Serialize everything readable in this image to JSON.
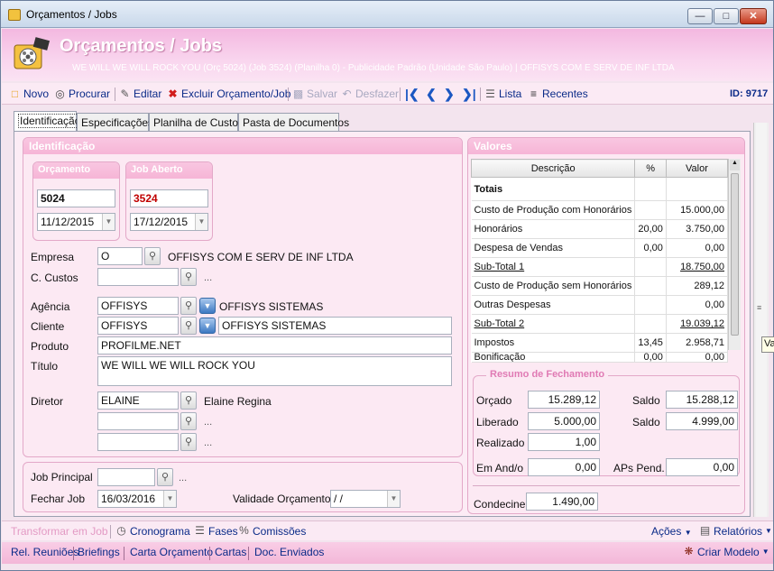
{
  "window": {
    "title": "Orçamentos / Jobs"
  },
  "banner": {
    "title": "Orçamentos / Jobs",
    "subtitle": "WE WILL WE WILL ROCK YOU (Orç 5024) (Job 3524)  (Planilha 0) - Publicidade Padrão (Unidade São Paulo) | OFFISYS COM E SERV DE INF LTDA"
  },
  "toolbar": {
    "novo": "Novo",
    "procurar": "Procurar",
    "editar": "Editar",
    "excluir": "Excluir Orçamento/Job",
    "salvar": "Salvar",
    "desfazer": "Desfazer",
    "lista": "Lista",
    "recentes": "Recentes",
    "id": "ID: 9717"
  },
  "tabs": [
    "Identificação",
    "Especificações",
    "Planilha de Custos",
    "Pasta de Documentos"
  ],
  "identificacao": {
    "header": "Identificação",
    "orcamento": {
      "label": "Orçamento",
      "number": "5024",
      "date": "11/12/2015"
    },
    "job": {
      "label": "Job Aberto",
      "number": "3524",
      "date": "17/12/2015"
    },
    "empresa": {
      "label": "Empresa",
      "code": "O",
      "name": "OFFISYS COM E SERV DE INF LTDA"
    },
    "custos": {
      "label": "C. Custos",
      "value": "",
      "dots": "..."
    },
    "agencia": {
      "label": "Agência",
      "code": "OFFISYS",
      "name": "OFFISYS SISTEMAS"
    },
    "cliente": {
      "label": "Cliente",
      "code": "OFFISYS",
      "name": "OFFISYS SISTEMAS"
    },
    "produto": {
      "label": "Produto",
      "value": "PROFILME.NET"
    },
    "titulo": {
      "label": "Título",
      "value": "WE WILL WE WILL ROCK YOU"
    },
    "diretor": {
      "label": "Diretor",
      "code": "ELAINE",
      "name": "Elaine Regina",
      "dots": "..."
    },
    "job_principal": {
      "label": "Job Principal",
      "value": "",
      "dots": "..."
    },
    "fechar_job": {
      "label": "Fechar Job",
      "value": "16/03/2016"
    },
    "validade": {
      "label": "Validade Orçamento",
      "value": " / /"
    }
  },
  "valores": {
    "header": "Valores",
    "columns": [
      "Descrição",
      "%",
      "Valor"
    ],
    "rows": [
      {
        "desc": "Totais",
        "pct": "",
        "valor": "",
        "style": "bold"
      },
      {
        "desc": "Custo de Produção com Honorários",
        "pct": "",
        "valor": "15.000,00",
        "style": ""
      },
      {
        "desc": "Honorários",
        "pct": "20,00",
        "valor": "3.750,00",
        "style": ""
      },
      {
        "desc": "Despesa de Vendas",
        "pct": "0,00",
        "valor": "0,00",
        "style": ""
      },
      {
        "desc": "Sub-Total 1",
        "pct": "",
        "valor": "18.750,00",
        "style": "underline"
      },
      {
        "desc": "Custo de Produção sem Honorários",
        "pct": "",
        "valor": "289,12",
        "style": ""
      },
      {
        "desc": "Outras Despesas",
        "pct": "",
        "valor": "0,00",
        "style": ""
      },
      {
        "desc": "Sub-Total 2",
        "pct": "",
        "valor": "19.039,12",
        "style": "underline"
      },
      {
        "desc": "Impostos",
        "pct": "13,45",
        "valor": "2.958,71",
        "style": ""
      },
      {
        "desc": "Bonificação",
        "pct": "0,00",
        "valor": "0,00",
        "style": ""
      }
    ],
    "resumo": {
      "legend": "Resumo de Fechamento",
      "orcado": {
        "label": "Orçado",
        "value": "15.289,12"
      },
      "saldo1": {
        "label": "Saldo",
        "value": "15.288,12"
      },
      "liberado": {
        "label": "Liberado",
        "value": "5.000,00"
      },
      "saldo2": {
        "label": "Saldo",
        "value": "4.999,00"
      },
      "realizado": {
        "label": "Realizado",
        "value": "1,00"
      },
      "em_and": {
        "label": "Em And/o",
        "value": "0,00"
      },
      "aps": {
        "label": "APs Pend.",
        "value": "0,00"
      }
    },
    "condecine": {
      "label": "Condecine",
      "value": "1.490,00"
    }
  },
  "bottom1": {
    "transformar": "Transformar em Job",
    "cronograma": "Cronograma",
    "fases": "Fases",
    "comissoes": "Comissões",
    "acoes": "Ações",
    "relatorios": "Relatórios"
  },
  "bottom2": {
    "reunioes": "Rel. Reuniões",
    "briefings": "Briefings",
    "carta": "Carta Orçamento",
    "cartas": "Cartas",
    "docs": "Doc. Enviados",
    "criar": "Criar Modelo"
  },
  "tooltip_fragment": "Va"
}
